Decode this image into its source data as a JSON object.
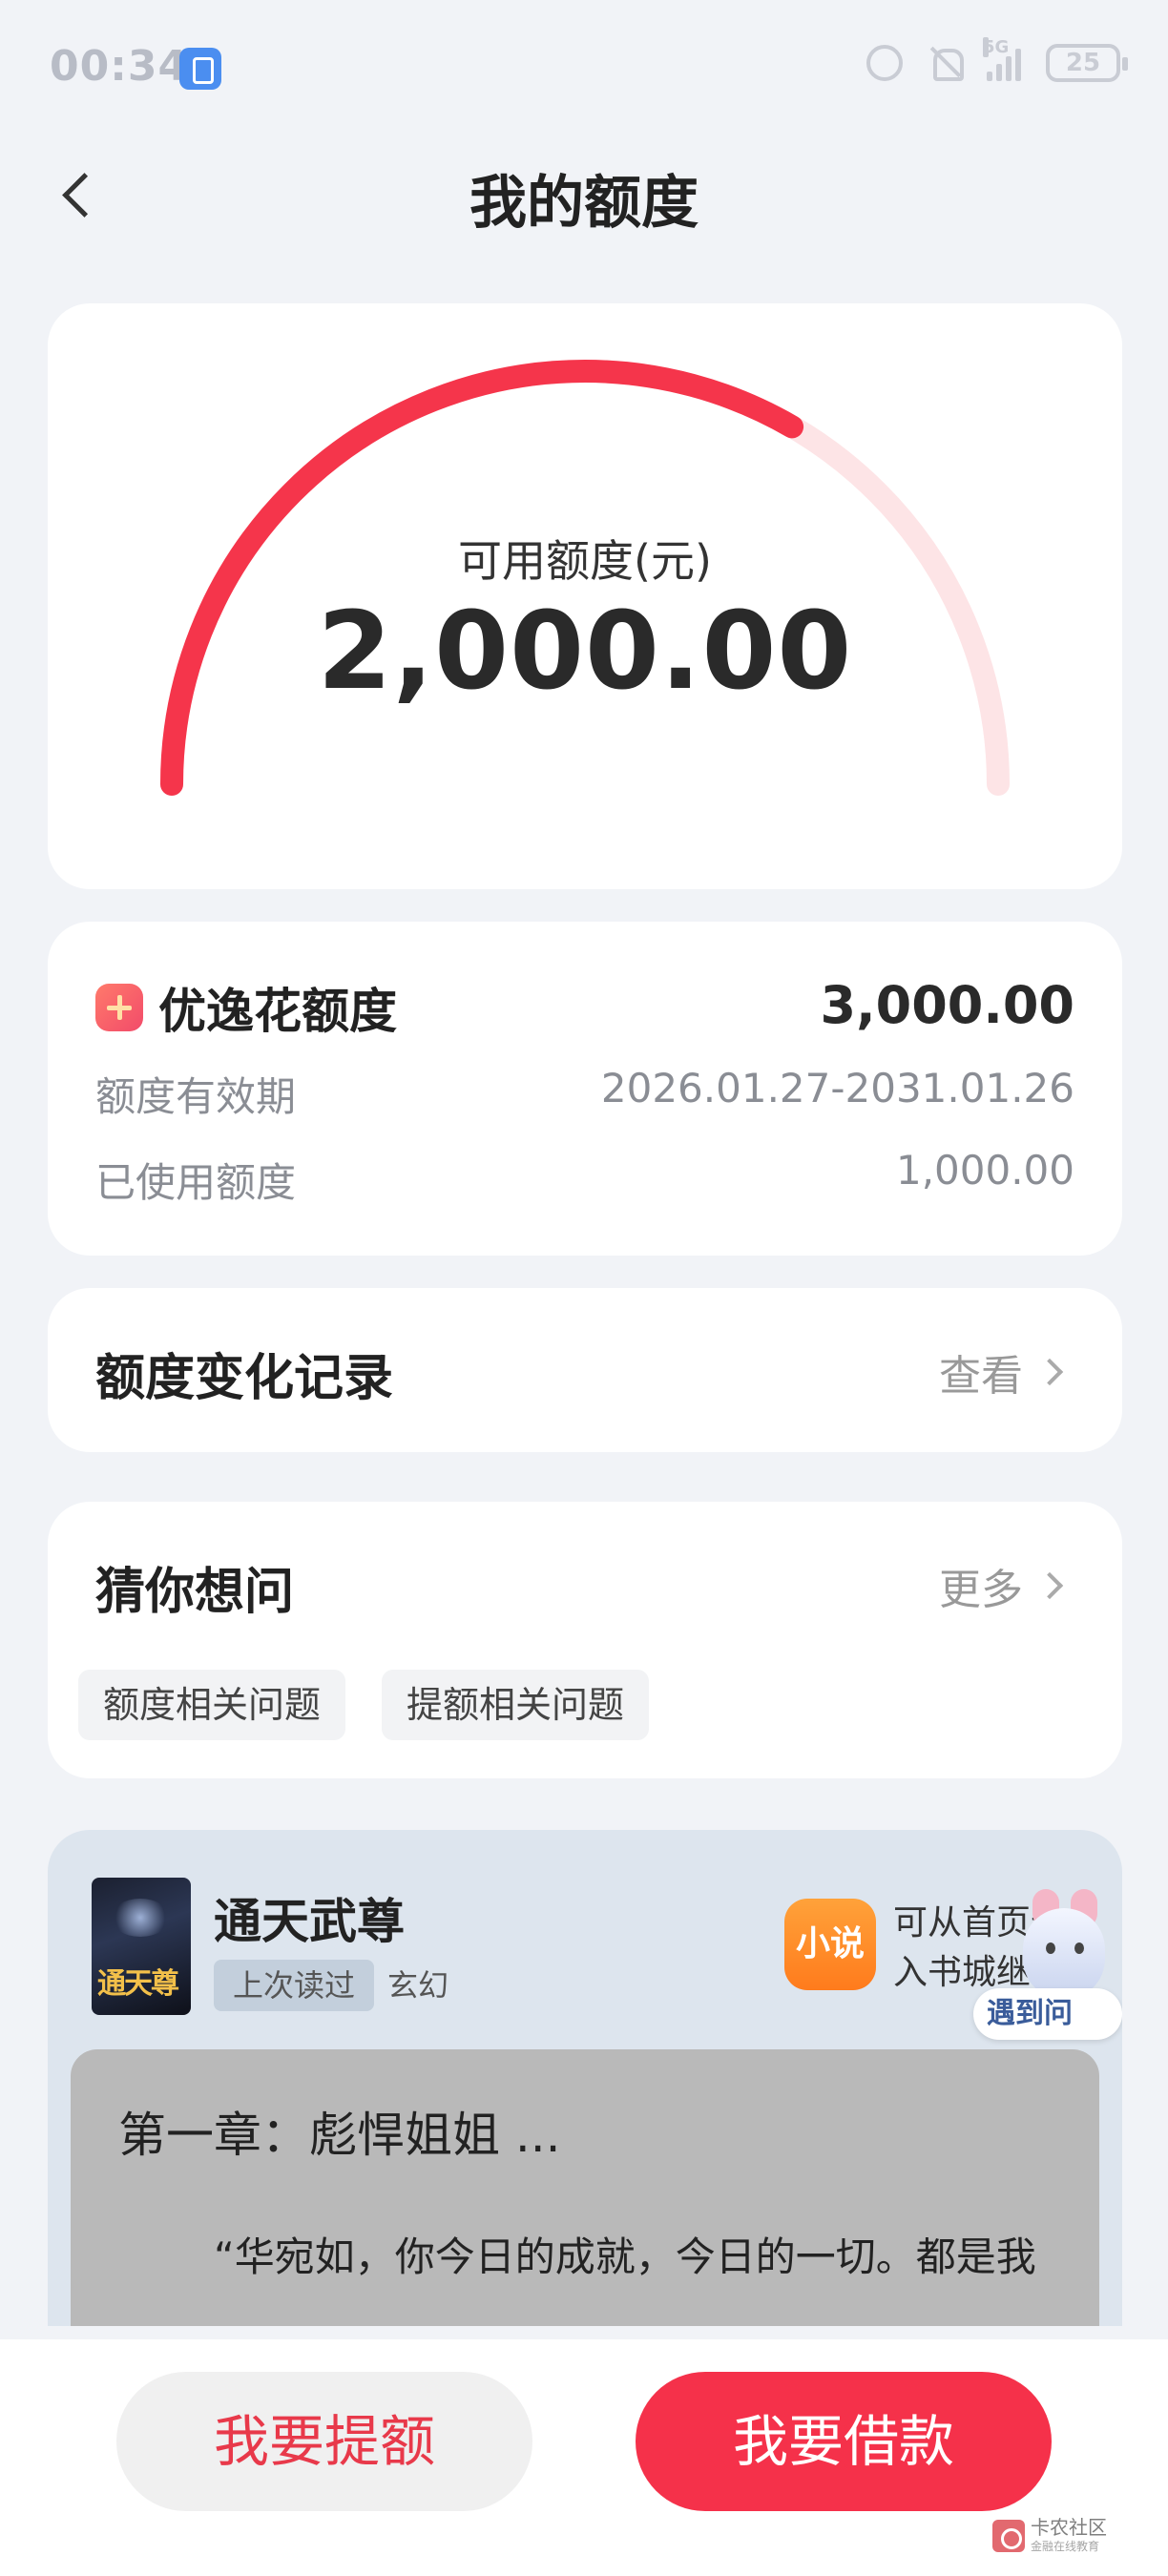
{
  "status_bar": {
    "time": "00:34",
    "network": "5G",
    "battery": "25"
  },
  "header": {
    "title": "我的额度"
  },
  "gauge": {
    "label": "可用额度(元)",
    "value": "2,000.00",
    "used_fraction": 0.667,
    "colors": {
      "active": "#f5354b",
      "track": "#fde4e6"
    }
  },
  "credit": {
    "title": "优逸花额度",
    "total": "3,000.00",
    "rows": [
      {
        "label": "额度有效期",
        "value": "2026.01.27-2031.01.26"
      },
      {
        "label": "已使用额度",
        "value": "1,000.00"
      }
    ]
  },
  "record": {
    "title": "额度变化记录",
    "link": "查看"
  },
  "faq": {
    "title": "猜你想问",
    "link": "更多",
    "tags": [
      "额度相关问题",
      "提额相关问题"
    ]
  },
  "novel": {
    "cover_text": "通天尊",
    "title": "通天武尊",
    "tag": "上次读过",
    "genre": "玄幻",
    "app_icon_label": "小说",
    "app_hint": "可从首页进入书城继续",
    "help": "遇到问题?",
    "chapter_title": "第一章：彪悍姐姐 ...",
    "chapter_text": "“华宛如，你今日的成就，今日的一切。都是我"
  },
  "actions": {
    "raise": "我要提额",
    "borrow": "我要借款"
  },
  "watermark": {
    "text": "卡农社区",
    "sub": "金融在线教育"
  }
}
